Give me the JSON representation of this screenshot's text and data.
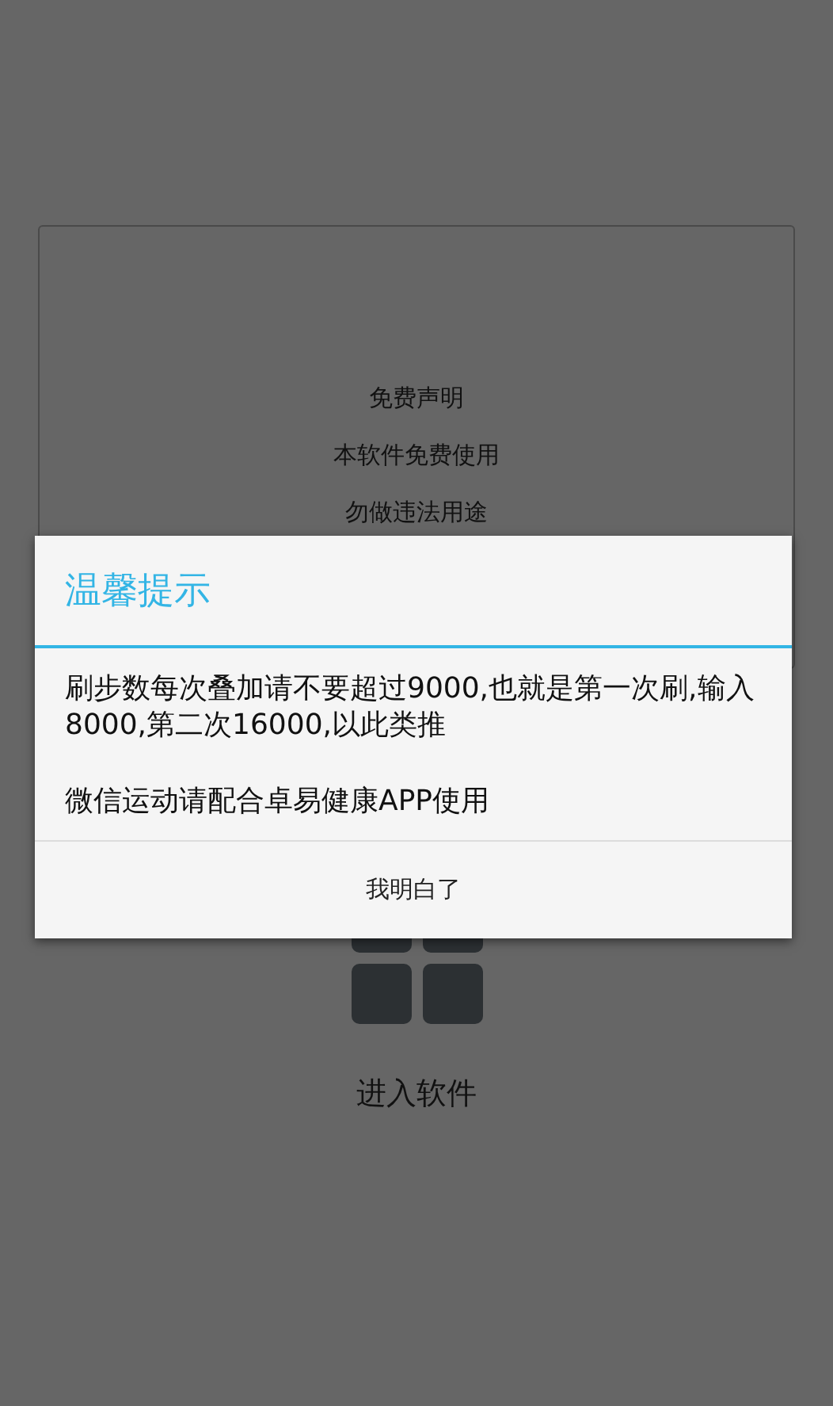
{
  "background": {
    "disclaimer_card": {
      "lines": [
        "免费声明",
        "本软件免费使用",
        "勿做违法用途"
      ]
    },
    "launcher": {
      "label": "进入软件"
    }
  },
  "dialog": {
    "title": "温馨提示",
    "paragraphs": [
      "刷步数每次叠加请不要超过9000,也就是第一次刷,输入8000,第二次16000,以此类推",
      "微信运动请配合卓易健康APP使用"
    ],
    "button": "我明白了"
  }
}
